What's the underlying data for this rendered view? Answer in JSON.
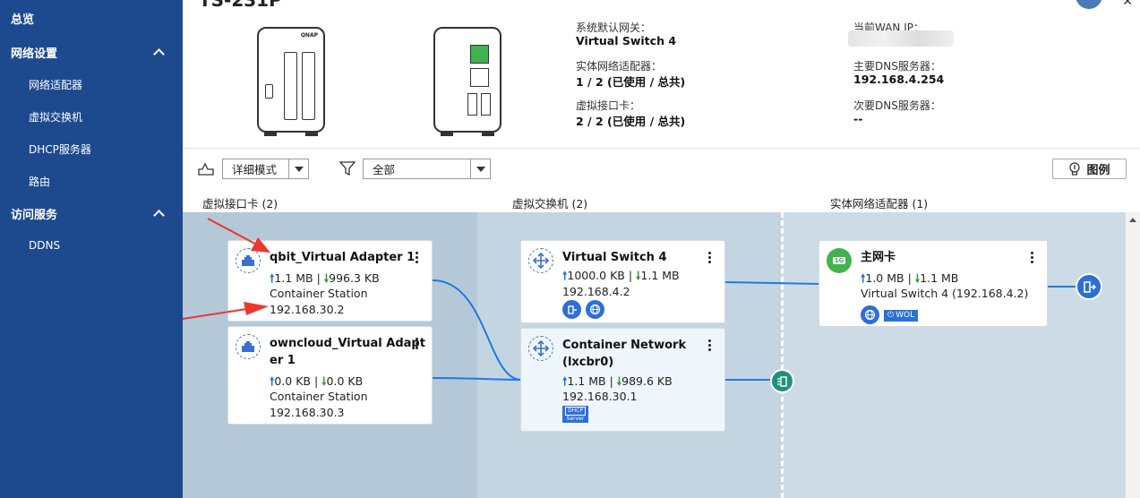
{
  "sidebar": {
    "overview": "总览",
    "network_settings": "网络设置",
    "adapters": "网络适配器",
    "virtual_switch": "虚拟交换机",
    "dhcp": "DHCP服务器",
    "routing": "路由",
    "access_services": "访问服务",
    "ddns": "DDNS"
  },
  "header": {
    "title": "TS-231P",
    "gateway_label": "系统默认网关：",
    "gateway_value": "Virtual Switch 4",
    "phys_adapter_label": "实体网络适配器：",
    "phys_adapter_value": "1 / 2 (已使用 / 总共)",
    "vif_label": "虚拟接口卡：",
    "vif_value": "2 / 2 (已使用 / 总共)",
    "wan_ip_label": "当前WAN IP：",
    "dns1_label": "主要DNS服务器：",
    "dns1_value": "192.168.4.254",
    "dns2_label": "次要DNS服务器：",
    "dns2_value": "--",
    "nas_brand": "QNAP"
  },
  "toolbar": {
    "mode_value": "详细模式",
    "filter_value": "全部",
    "legend_label": "图例"
  },
  "columns": {
    "vif": "虚拟接口卡 (2)",
    "vswitch": "虚拟交换机 (2)",
    "phys": "实体网络适配器 (1)"
  },
  "vif_cards": [
    {
      "name": "qbit_Virtual Adapter 1",
      "tx": "1.1 MB",
      "rx": "996.3 KB",
      "source": "Container Station",
      "ip": "192.168.30.2"
    },
    {
      "name_line1": "owncloud_Virtual Adapt",
      "name_line2": "er 1",
      "tx": "0.0 KB",
      "rx": "0.0 KB",
      "source": "Container Station",
      "ip": "192.168.30.3"
    }
  ],
  "switch_cards": [
    {
      "name": "Virtual Switch 4",
      "tx": "1000.0 KB",
      "rx": "1.1 MB",
      "ip": "192.168.4.2"
    },
    {
      "name_line1": "Container Network",
      "name_line2": "(lxcbr0)",
      "tx": "1.1 MB",
      "rx": "989.6 KB",
      "ip": "192.168.30.1",
      "badge_top": "DHCP",
      "badge_bottom": "Server"
    }
  ],
  "phys_cards": [
    {
      "name": "主网卡",
      "tx": "1.0 MB",
      "rx": "1.1 MB",
      "detail": "Virtual Switch 4 (192.168.4.2)",
      "wol": "WOL",
      "port_badge": "1G"
    }
  ],
  "sep": " | ",
  "colors": {
    "sidebar": "#1d4a8f",
    "accent_blue": "#2d6fd8",
    "teal": "#20907c",
    "link_line": "#1f7ae0",
    "arrow_red": "#e8392f",
    "green_port": "#3fb34f"
  }
}
